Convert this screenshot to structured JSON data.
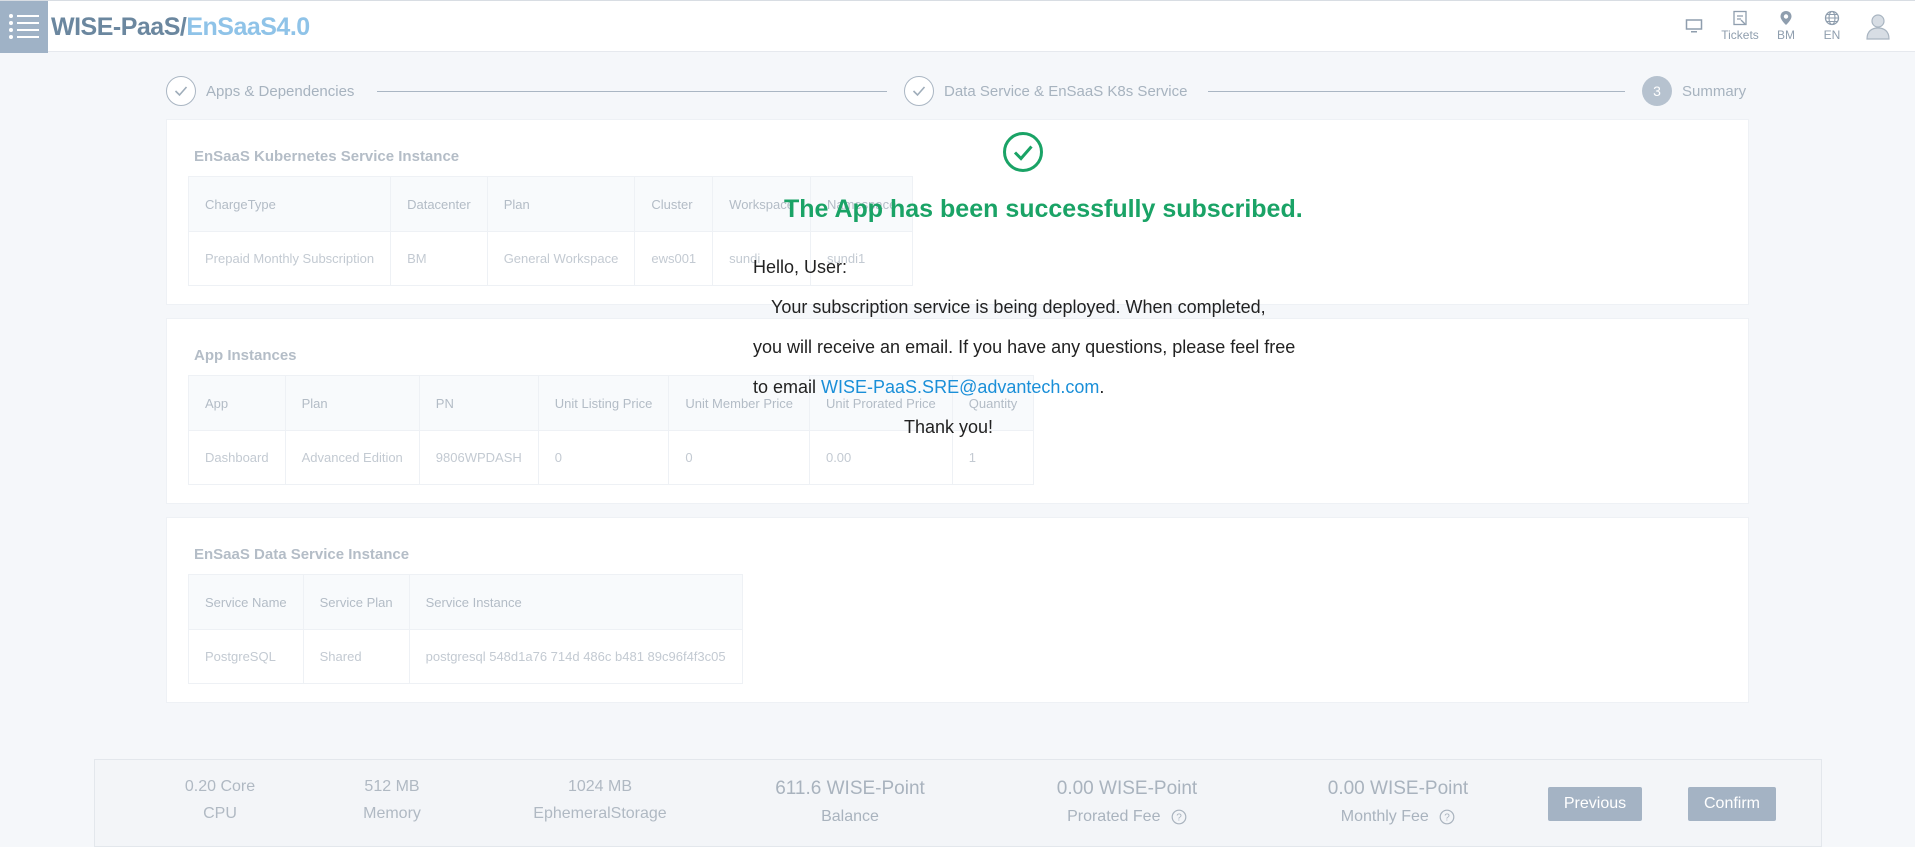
{
  "header": {
    "logo_part1": "WISE-PaaS/",
    "logo_part2": "EnSaaS4.0",
    "items": [
      {
        "icon": "monitor-icon",
        "label": ""
      },
      {
        "icon": "ticket-icon",
        "label": "Tickets"
      },
      {
        "icon": "location-pin-icon",
        "label": "BM"
      },
      {
        "icon": "globe-icon",
        "label": "EN"
      },
      {
        "icon": "user-avatar-icon",
        "label": ""
      }
    ]
  },
  "stepper": {
    "step1": "Apps & Dependencies",
    "step2": "Data Service & EnSaaS K8s Service",
    "step3_number": "3",
    "step3": "Summary"
  },
  "k8s_section": {
    "title": "EnSaaS Kubernetes Service Instance",
    "headers": [
      "ChargeType",
      "Datacenter",
      "Plan",
      "Cluster",
      "Workspace",
      "Namespace"
    ],
    "row": [
      "Prepaid Monthly Subscription",
      "BM",
      "General Workspace",
      "ews001",
      "sundi",
      "sundi1"
    ]
  },
  "apps_section": {
    "title": "App Instances",
    "headers": [
      "App",
      "Plan",
      "PN",
      "Unit Listing Price",
      "Unit Member Price",
      "Unit Prorated Price",
      "Quantity"
    ],
    "row": [
      "Dashboard",
      "Advanced Edition",
      "9806WPDASH",
      "0",
      "0",
      "0.00",
      "1"
    ]
  },
  "data_section": {
    "title": "EnSaaS Data Service Instance",
    "headers": [
      "Service Name",
      "Service Plan",
      "Service Instance"
    ],
    "row": [
      "PostgreSQL",
      "Shared",
      "postgresql 548d1a76 714d 486c b481 89c96f4f3c05"
    ]
  },
  "footer": {
    "cpu_value": "0.20 Core",
    "cpu_label": "CPU",
    "memory_value": "512 MB",
    "memory_label": "Memory",
    "storage_value": "1024 MB",
    "storage_label": "EphemeralStorage",
    "balance_value": "611.6 WISE-Point",
    "balance_label": "Balance",
    "prorated_value": "0.00 WISE-Point",
    "prorated_label": "Prorated Fee",
    "monthly_value": "0.00 WISE-Point",
    "monthly_label": "Monthly Fee",
    "previous_label": "Previous",
    "confirm_label": "Confirm"
  },
  "overlay": {
    "title": "The App has been successfully subscribed.",
    "greeting": "Hello, User:",
    "line1": "Your subscription service is being deployed. When completed,",
    "line2": "you will receive an email. If you have any questions, please feel free",
    "line3_prefix": "to email ",
    "email": "WISE-PaaS.SRE@advantech.com",
    "line3_suffix": ".",
    "thanks": "Thank you!"
  },
  "colors": {
    "success": "#1aa366",
    "link": "#1a8fd8",
    "header_accent": "#9fb2c6"
  }
}
